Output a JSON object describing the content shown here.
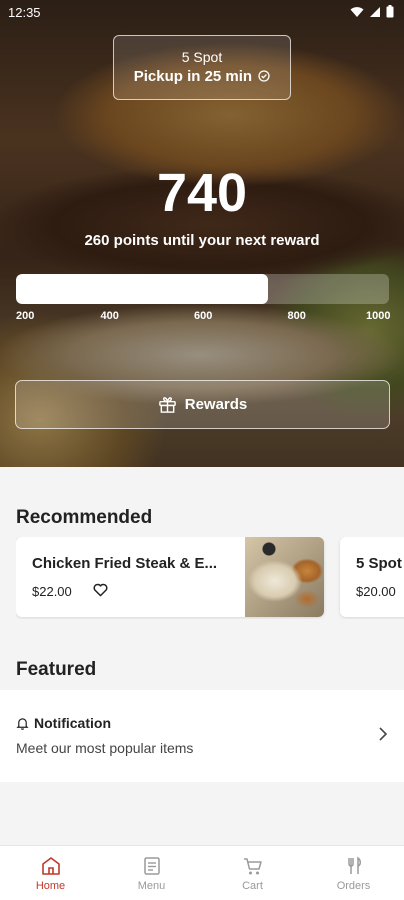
{
  "status_bar": {
    "time": "12:35"
  },
  "hero": {
    "store_name": "5 Spot",
    "pickup_text": "Pickup in 25 min",
    "points": "740",
    "until_text": "260 points until your next reward",
    "progress": {
      "value": 740,
      "min": 200,
      "max": 1000
    },
    "ticks": [
      "200",
      "400",
      "600",
      "800",
      "1000"
    ],
    "rewards_label": "Rewards"
  },
  "recommended": {
    "title": "Recommended",
    "items": [
      {
        "name": "Chicken Fried Steak & E...",
        "price": "$22.00"
      },
      {
        "name": "5 Spot",
        "price": "$20.00"
      }
    ]
  },
  "featured": {
    "title": "Featured",
    "notification_title": "Notification",
    "notification_text": "Meet our most popular items"
  },
  "nav": {
    "items": [
      {
        "label": "Home",
        "icon": "home-icon"
      },
      {
        "label": "Menu",
        "icon": "menu-icon"
      },
      {
        "label": "Cart",
        "icon": "cart-icon"
      },
      {
        "label": "Orders",
        "icon": "orders-icon"
      }
    ]
  },
  "colors": {
    "accent": "#c0392b",
    "nav_inactive": "#9a9a9a"
  }
}
